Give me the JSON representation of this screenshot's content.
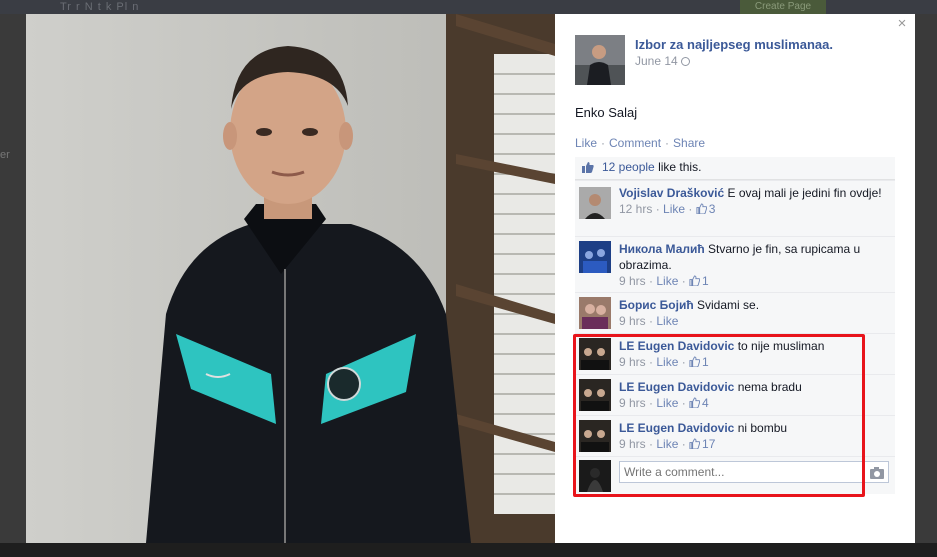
{
  "background": {
    "topbar_text": "Tr   r   N   t   k   Pl   n",
    "button_label": "Create Page",
    "left_fragment": "er"
  },
  "post": {
    "page_name": "Izbor za najljepseg muslimanaa.",
    "date": "June 14",
    "caption": "Enko Salaj",
    "actions": {
      "like": "Like",
      "comment": "Comment",
      "share": "Share"
    },
    "likes": {
      "count_text": "12 people",
      "suffix": "like this."
    }
  },
  "comments": [
    {
      "author": "Vojislav Drašković",
      "text": "E ovaj mali je jedini fin ovdje!",
      "time": "12 hrs",
      "like_label": "Like",
      "likes": "3"
    },
    {
      "author": "Никола Малић",
      "text": "Stvarno je fin, sa rupicama u obrazima.",
      "time": "9 hrs",
      "like_label": "Like",
      "likes": "1"
    },
    {
      "author": "Борис Бојић",
      "text": "Svidami se.",
      "time": "9 hrs",
      "like_label": "Like",
      "likes": ""
    },
    {
      "author": "LE Eugen Davidovic",
      "text": "to nije musliman",
      "time": "9 hrs",
      "like_label": "Like",
      "likes": "1"
    },
    {
      "author": "LE Eugen Davidovic",
      "text": "nema bradu",
      "time": "9 hrs",
      "like_label": "Like",
      "likes": "4"
    },
    {
      "author": "LE Eugen Davidovic",
      "text": "ni bombu",
      "time": "9 hrs",
      "like_label": "Like",
      "likes": "17"
    }
  ],
  "composer": {
    "placeholder": "Write a comment..."
  },
  "colors": {
    "link": "#3b5998",
    "highlight": "#e8141b",
    "jacket_accent": "#2ec4c0"
  },
  "icons": [
    "close-icon",
    "globe-icon",
    "like-thumb-icon",
    "camera-icon"
  ]
}
